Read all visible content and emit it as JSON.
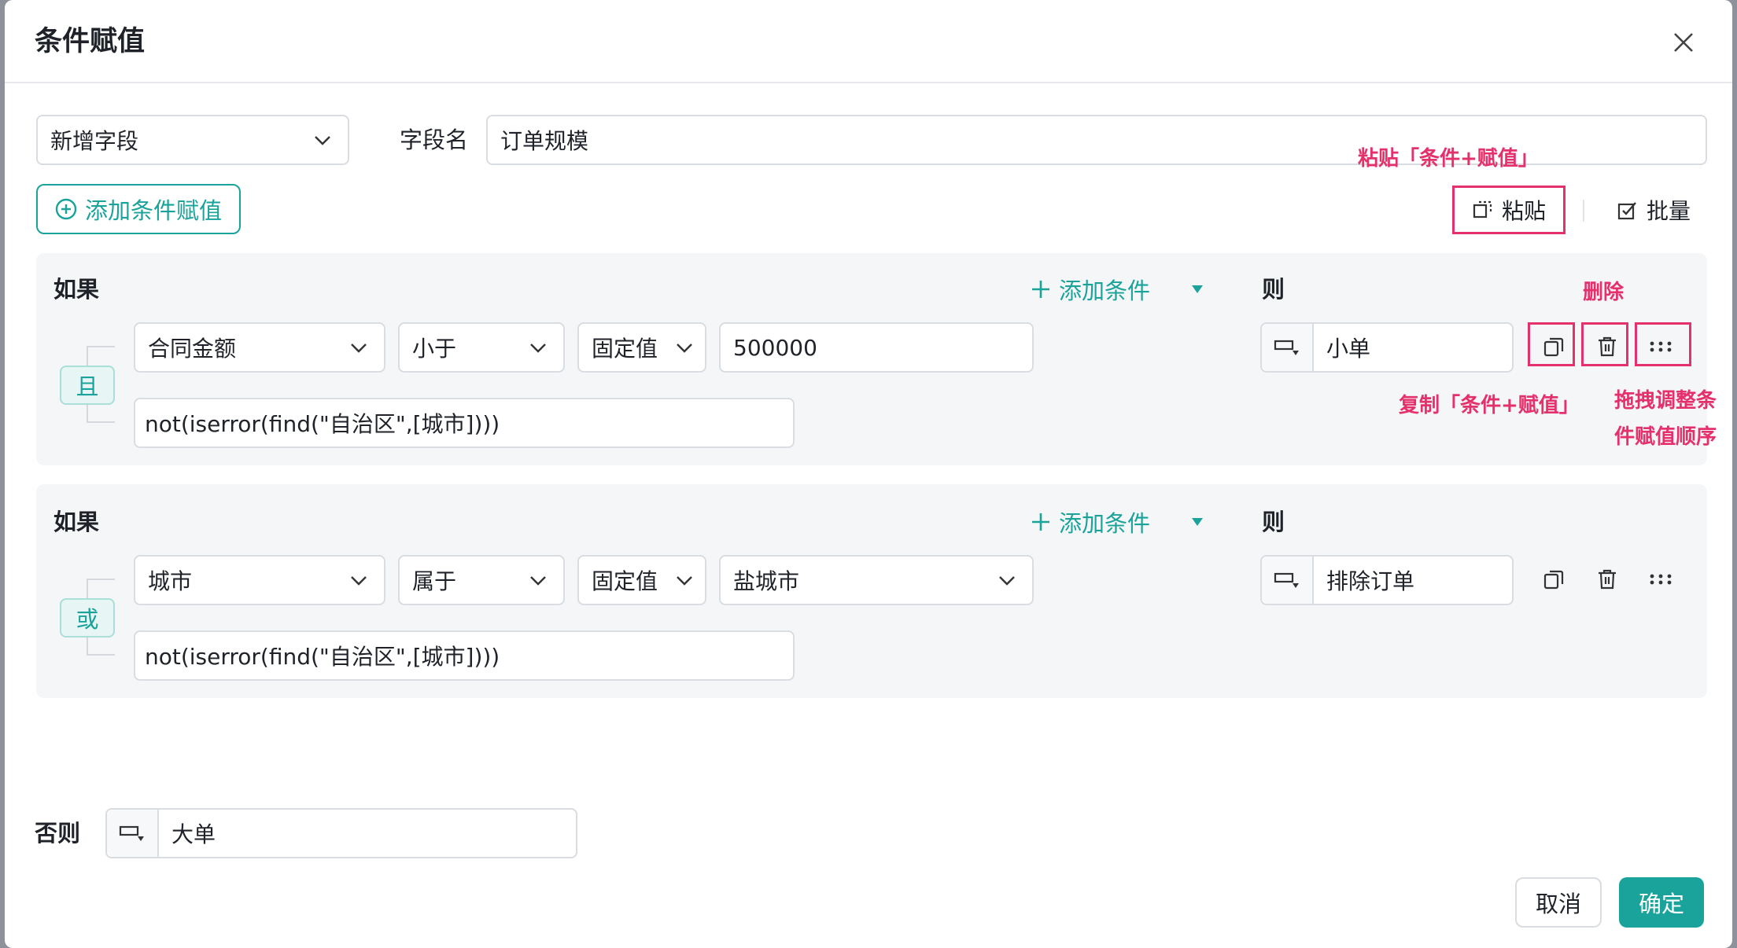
{
  "dialog": {
    "title": "条件赋值"
  },
  "top": {
    "field_mode_value": "新增字段",
    "field_name_label": "字段名",
    "field_name_value": "订单规模",
    "add_condition_assignment_label": "添加条件赋值",
    "paste_label": "粘贴",
    "batch_label": "批量"
  },
  "annotations": {
    "paste_note": "粘贴「条件+赋值」",
    "delete_note": "删除",
    "copy_note": "复制「条件+赋值」",
    "drag_note_line1": "拖拽调整条",
    "drag_note_line2": "件赋值顺序"
  },
  "rules": [
    {
      "if_label": "如果",
      "add_condition_label": "添加条件",
      "then_label": "则",
      "logic": "且",
      "field": "合同金额",
      "operator": "小于",
      "value_type": "固定值",
      "value": "500000",
      "formula": "not(iserror(find(\"自治区\",[城市])))",
      "result": "小单"
    },
    {
      "if_label": "如果",
      "add_condition_label": "添加条件",
      "then_label": "则",
      "logic": "或",
      "field": "城市",
      "operator": "属于",
      "value_type": "固定值",
      "value": "盐城市",
      "formula": "not(iserror(find(\"自治区\",[城市])))",
      "result": "排除订单"
    }
  ],
  "else": {
    "label": "否则",
    "value": "大单"
  },
  "footer": {
    "cancel_label": "取消",
    "ok_label": "确定"
  },
  "colors": {
    "accent": "#1aa39a",
    "annotation": "#e4306b"
  },
  "icons": [
    "close-icon",
    "chevron-down-icon",
    "plus-circle-icon",
    "paste-icon",
    "batch-icon",
    "plus-icon",
    "caret-down-icon",
    "value-type-icon",
    "copy-icon",
    "trash-icon",
    "drag-handle-icon"
  ]
}
